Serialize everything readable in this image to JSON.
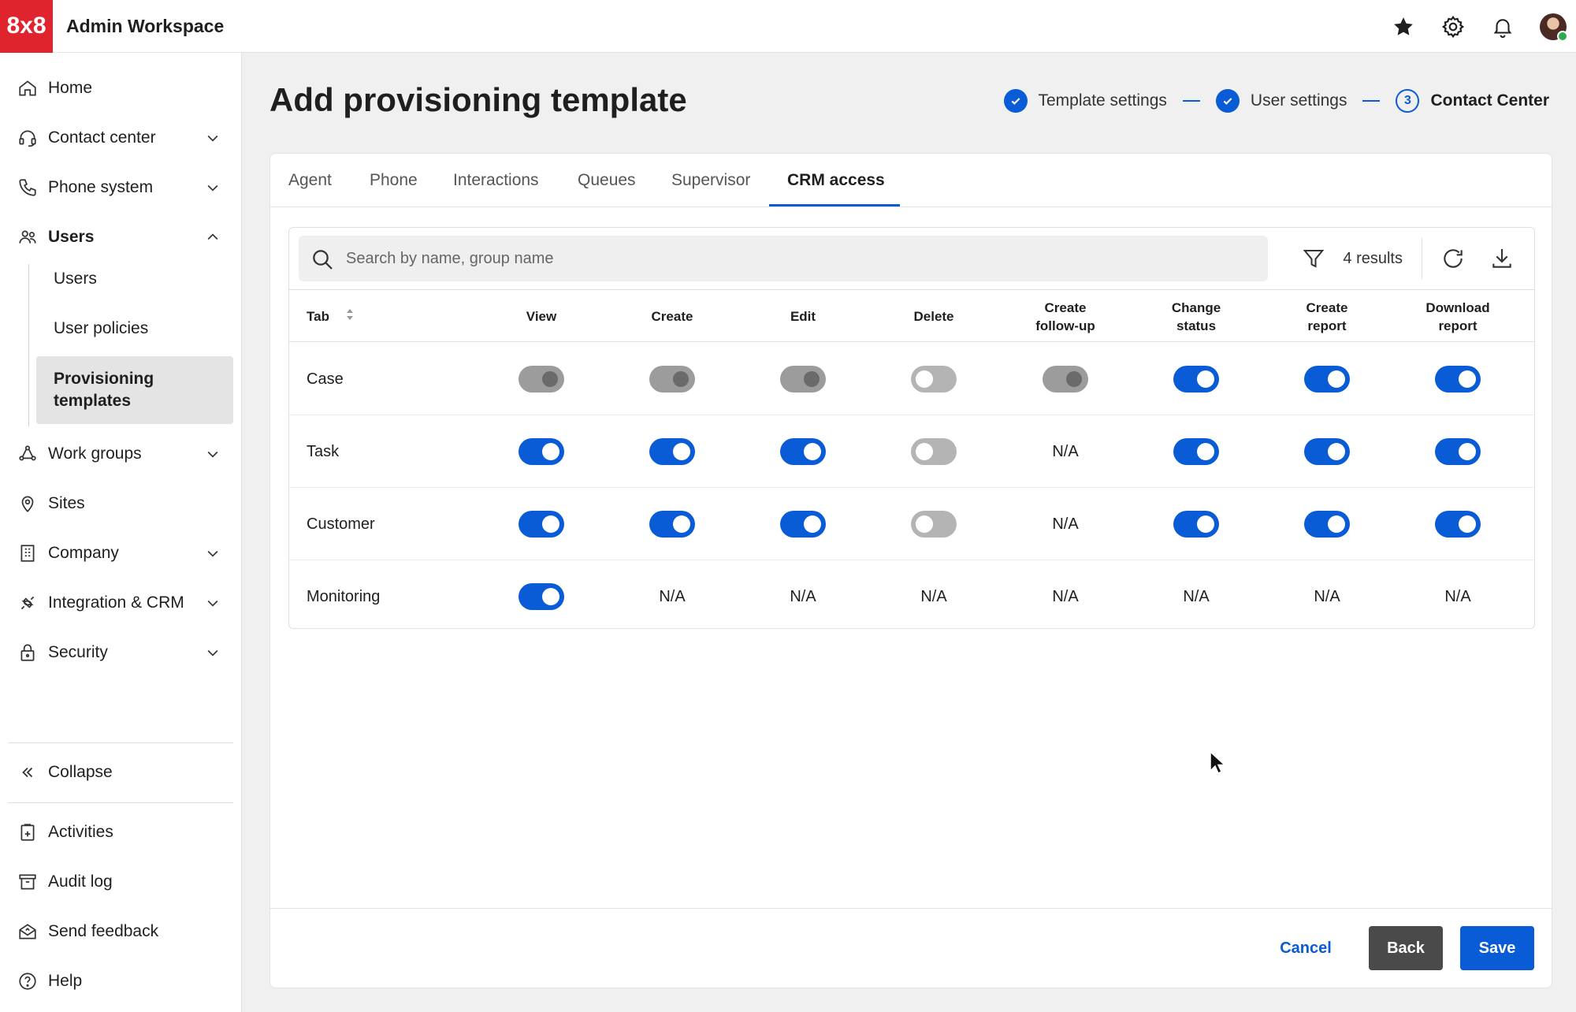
{
  "app": {
    "logo": "8x8",
    "title": "Admin Workspace"
  },
  "topbar": {
    "icons": [
      "star-icon",
      "gear-icon",
      "bell-icon"
    ],
    "avatar_status": "online"
  },
  "sidebar": {
    "items": [
      {
        "label": "Home",
        "icon": "home-icon"
      },
      {
        "label": "Contact center",
        "icon": "headset-icon",
        "expandable": true
      },
      {
        "label": "Phone system",
        "icon": "phone-icon",
        "expandable": true
      },
      {
        "label": "Users",
        "icon": "users-icon",
        "expanded": true
      },
      {
        "label": "Work groups",
        "icon": "workgroups-icon",
        "expandable": true
      },
      {
        "label": "Sites",
        "icon": "location-pin-icon"
      },
      {
        "label": "Company",
        "icon": "building-icon",
        "expandable": true
      },
      {
        "label": "Integration & CRM",
        "icon": "integration-icon",
        "expandable": true
      },
      {
        "label": "Security",
        "icon": "lock-icon",
        "expandable": true
      }
    ],
    "users_sub": [
      "Users",
      "User policies"
    ],
    "users_sub_active": "Provisioning templates",
    "collapse": "Collapse",
    "bottom": [
      {
        "label": "Activities",
        "icon": "clipboard-icon"
      },
      {
        "label": "Audit log",
        "icon": "archive-box-icon"
      },
      {
        "label": "Send feedback",
        "icon": "feedback-icon"
      },
      {
        "label": "Help",
        "icon": "help-icon"
      }
    ]
  },
  "page": {
    "title": "Add provisioning template"
  },
  "stepper": {
    "steps": [
      {
        "label": "Template settings",
        "state": "done"
      },
      {
        "label": "User settings",
        "state": "done"
      },
      {
        "label": "Contact Center",
        "state": "current",
        "number": "3"
      }
    ]
  },
  "tabs": [
    "Agent",
    "Phone",
    "Interactions",
    "Queues",
    "Supervisor",
    "CRM access"
  ],
  "active_tab": "CRM access",
  "search": {
    "placeholder": "Search by name, group name",
    "value": ""
  },
  "results": "4 results",
  "table": {
    "columns": [
      "Tab",
      "View",
      "Create",
      "Edit",
      "Delete",
      "Create follow-up",
      "Change status",
      "Create report",
      "Download report"
    ],
    "column_headers_lines": [
      [
        "Tab"
      ],
      [
        "View"
      ],
      [
        "Create"
      ],
      [
        "Edit"
      ],
      [
        "Delete"
      ],
      [
        "Create",
        "follow-up"
      ],
      [
        "Change",
        "status"
      ],
      [
        "Create",
        "report"
      ],
      [
        "Download",
        "report"
      ]
    ],
    "na_text": "N/A",
    "rows": [
      {
        "name": "Case",
        "cells": [
          "disabled-on",
          "disabled-on",
          "disabled-on",
          "off",
          "disabled-on",
          "on",
          "on",
          "on"
        ]
      },
      {
        "name": "Task",
        "cells": [
          "on",
          "on",
          "on",
          "off",
          "N/A",
          "on",
          "on",
          "on"
        ]
      },
      {
        "name": "Customer",
        "cells": [
          "on",
          "on",
          "on",
          "off",
          "N/A",
          "on",
          "on",
          "on"
        ]
      },
      {
        "name": "Monitoring",
        "cells": [
          "on",
          "N/A",
          "N/A",
          "N/A",
          "N/A",
          "N/A",
          "N/A",
          "N/A"
        ]
      }
    ]
  },
  "footer": {
    "cancel": "Cancel",
    "back": "Back",
    "save": "Save"
  },
  "colors": {
    "brand_red": "#e0242d",
    "accent_blue": "#0a5bd6",
    "back_button": "#4a4a4a"
  }
}
